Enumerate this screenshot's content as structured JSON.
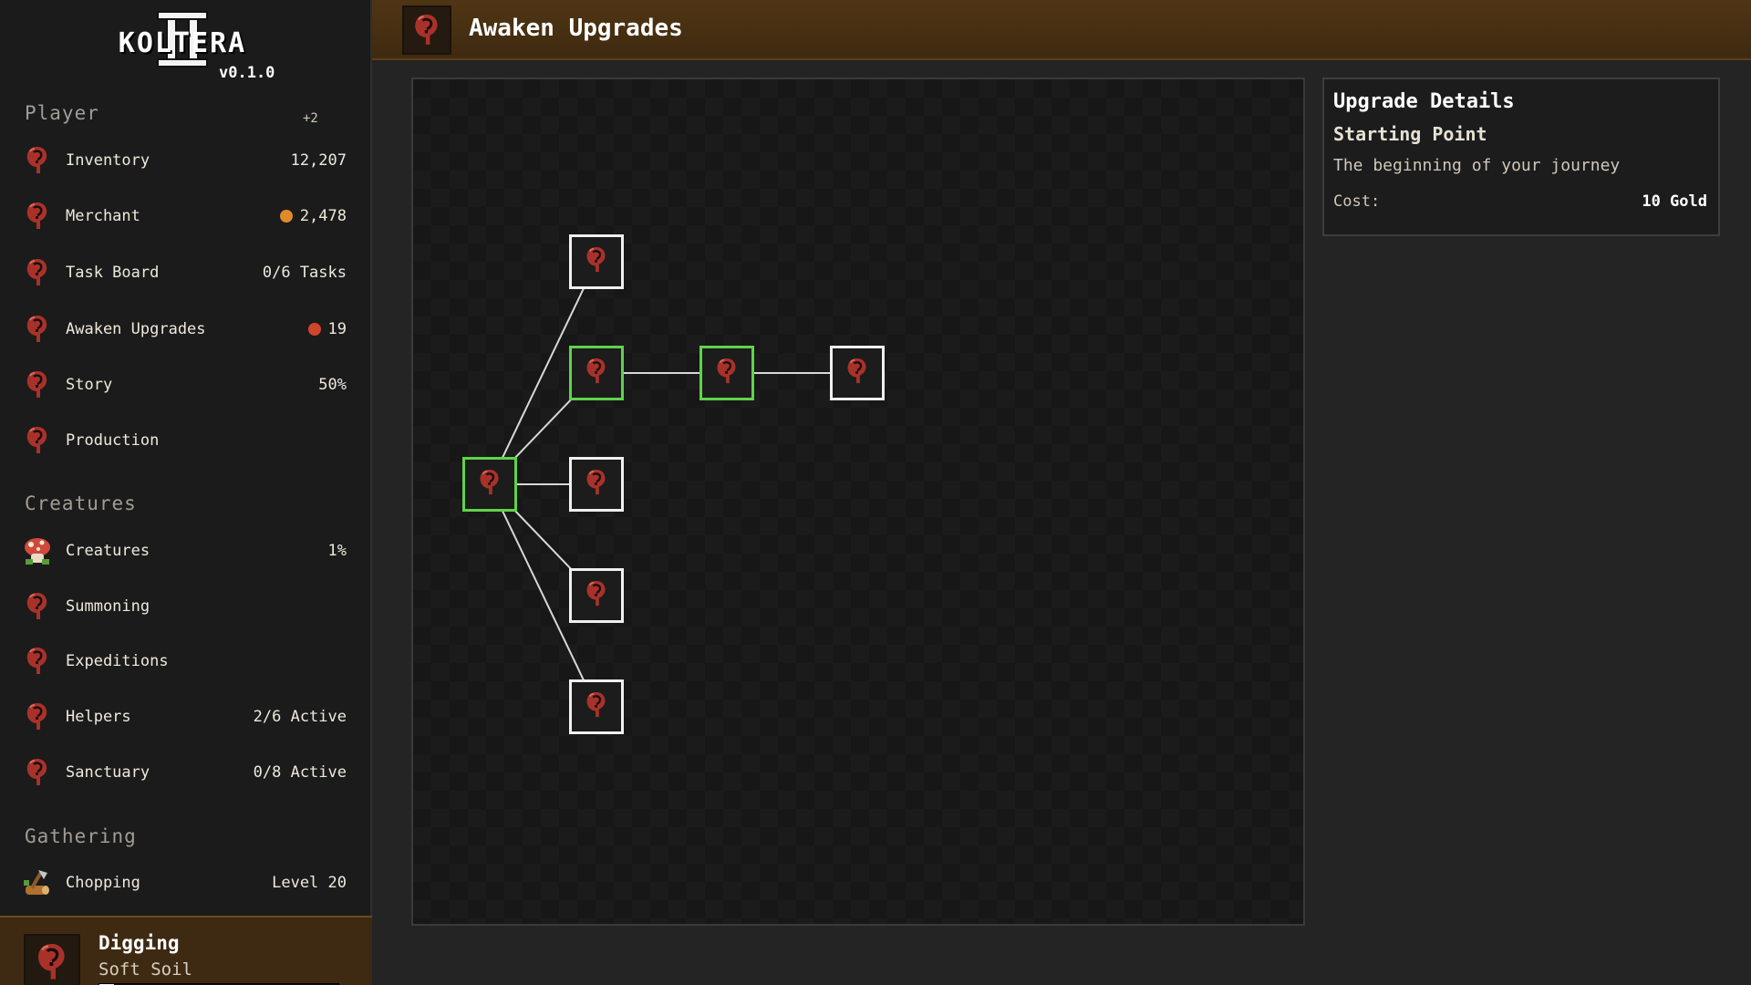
{
  "app": {
    "logo": "KOLTERA",
    "version": "v0.1.0"
  },
  "sidebar": {
    "sections": [
      {
        "title": "Player",
        "badge": "+2",
        "items": [
          {
            "label": "Inventory",
            "value": "12,207",
            "icon": "seed-icon"
          },
          {
            "label": "Merchant",
            "value": "2,478",
            "icon": "seed-icon",
            "dot_color": "#e08a2a"
          },
          {
            "label": "Task Board",
            "value": "0/6 Tasks",
            "icon": "seed-icon"
          },
          {
            "label": "Awaken Upgrades",
            "value": "19",
            "icon": "seed-icon",
            "dot_color": "#d2452b"
          },
          {
            "label": "Story",
            "value": "50%",
            "icon": "seed-icon"
          },
          {
            "label": "Production",
            "value": "",
            "icon": "seed-icon"
          }
        ]
      },
      {
        "title": "Creatures",
        "items": [
          {
            "label": "Creatures",
            "value": "1%",
            "icon": "mushroom-creature-icon"
          },
          {
            "label": "Summoning",
            "value": "",
            "icon": "seed-icon"
          },
          {
            "label": "Expeditions",
            "value": "",
            "icon": "seed-icon"
          },
          {
            "label": "Helpers",
            "value": "2/6 Active",
            "icon": "seed-icon"
          },
          {
            "label": "Sanctuary",
            "value": "0/8 Active",
            "icon": "seed-icon"
          }
        ]
      },
      {
        "title": "Gathering",
        "items": [
          {
            "label": "Chopping",
            "value": "Level 20",
            "icon": "axe-log-icon"
          }
        ]
      }
    ],
    "activity": {
      "title": "Digging",
      "subtitle": "Soft Soil",
      "progress": 0.06
    }
  },
  "header": {
    "title": "Awaken Upgrades",
    "icon": "seed-icon"
  },
  "tree": {
    "nodes": [
      {
        "id": "root",
        "state": "active"
      },
      {
        "id": "branch-top",
        "state": "locked"
      },
      {
        "id": "branch-upper",
        "state": "active"
      },
      {
        "id": "branch-upper-2",
        "state": "active"
      },
      {
        "id": "branch-upper-3",
        "state": "locked"
      },
      {
        "id": "branch-middle",
        "state": "locked"
      },
      {
        "id": "branch-lower",
        "state": "locked"
      },
      {
        "id": "branch-bottom",
        "state": "locked"
      }
    ],
    "edges": [
      [
        "root",
        "branch-top"
      ],
      [
        "root",
        "branch-upper"
      ],
      [
        "root",
        "branch-middle"
      ],
      [
        "root",
        "branch-lower"
      ],
      [
        "root",
        "branch-bottom"
      ],
      [
        "branch-upper",
        "branch-upper-2"
      ],
      [
        "branch-upper-2",
        "branch-upper-3"
      ]
    ]
  },
  "details": {
    "heading": "Upgrade Details",
    "name": "Starting Point",
    "description": "The beginning of your journey",
    "cost_label": "Cost:",
    "cost_value": "10 Gold"
  },
  "colors": {
    "active_border": "#5fd34a",
    "locked_border": "#f0f0f0",
    "seed_icon": "#a8322a",
    "header_bg": "#4f3514"
  }
}
